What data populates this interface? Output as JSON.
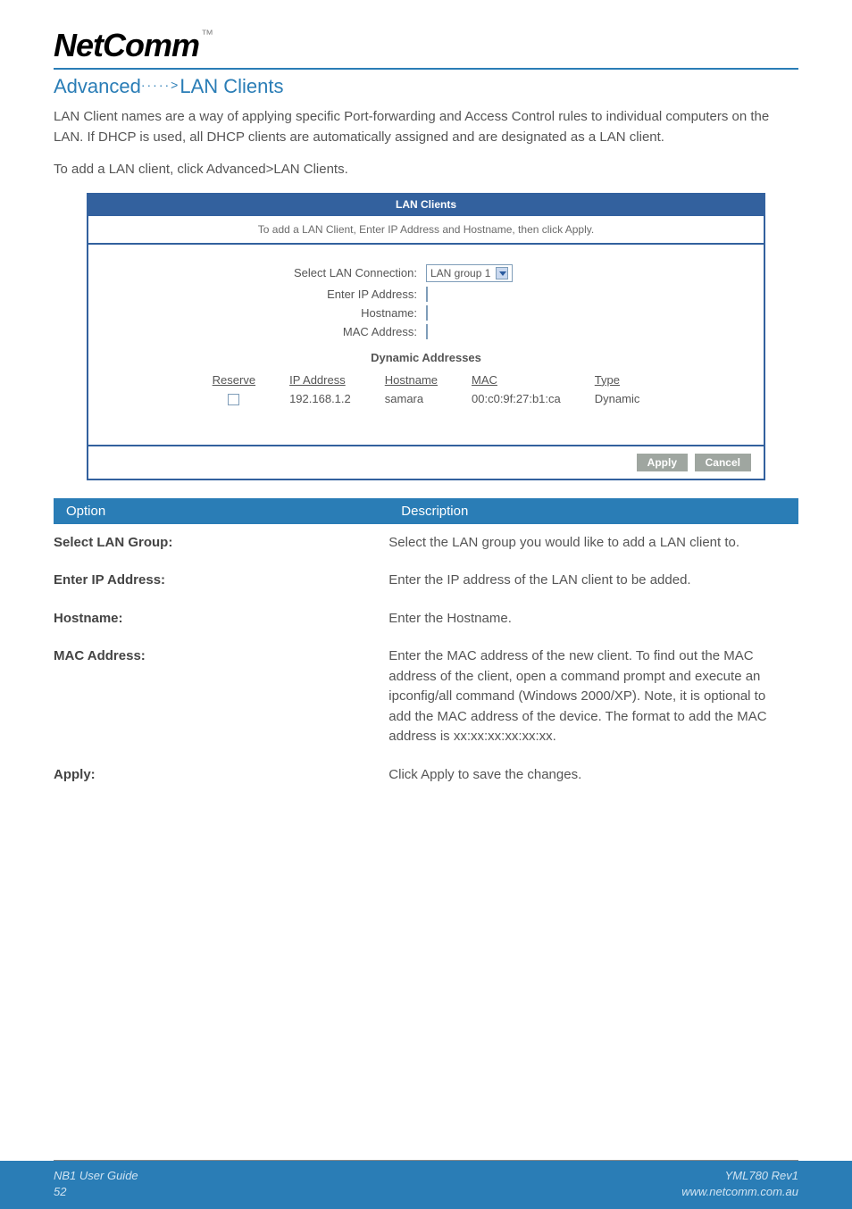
{
  "logo": {
    "text": "NetComm",
    "tm": "™"
  },
  "section_title": {
    "prefix": "Advanced",
    "arrow": "·····>",
    "suffix": "LAN Clients"
  },
  "intro_para": "LAN Client names are a way of applying specific Port-forwarding and Access Control rules to individual computers on the LAN.  If DHCP is used, all DHCP clients are automatically assigned and are designated as a LAN client.",
  "intro_para2": "To add a LAN client, click Advanced>LAN Clients.",
  "screenshot": {
    "titlebar": "LAN Clients",
    "subhead": "To add a LAN Client, Enter IP Address and Hostname, then click Apply.",
    "form": {
      "select_label": "Select LAN Connection:",
      "select_value": "LAN group 1",
      "ip_label": "Enter IP Address:",
      "hostname_label": "Hostname:",
      "mac_label": "MAC Address:"
    },
    "dyn_title": "Dynamic Addresses",
    "dyn_headers": {
      "reserve": "Reserve",
      "ip": "IP Address",
      "host": "Hostname",
      "mac": "MAC",
      "type": "Type"
    },
    "dyn_row": {
      "ip": "192.168.1.2",
      "host": "samara",
      "mac": "00:c0:9f:27:b1:ca",
      "type": "Dynamic"
    },
    "buttons": {
      "apply": "Apply",
      "cancel": "Cancel"
    }
  },
  "options_header": {
    "option": "Option",
    "description": "Description"
  },
  "options": [
    {
      "label": "Select LAN Group:",
      "desc": "Select the LAN group you would like to add a LAN client to."
    },
    {
      "label": "Enter IP Address:",
      "desc": "Enter the IP address of the LAN client to be added."
    },
    {
      "label": "Hostname:",
      "desc": "Enter the Hostname."
    },
    {
      "label": "MAC Address:",
      "desc": "Enter the MAC address of the new client. To find out the MAC address of the client, open a command prompt and execute an ipconfig/all command (Windows 2000/XP).  Note, it is optional to add the MAC address of the device. The format to add the MAC address is xx:xx:xx:xx:xx:xx."
    },
    {
      "label": "Apply:",
      "desc": "Click Apply to save the changes."
    }
  ],
  "footer": {
    "left1": "NB1 User Guide",
    "left2": "52",
    "right1": "YML780 Rev1",
    "right2": "www.netcomm.com.au"
  }
}
